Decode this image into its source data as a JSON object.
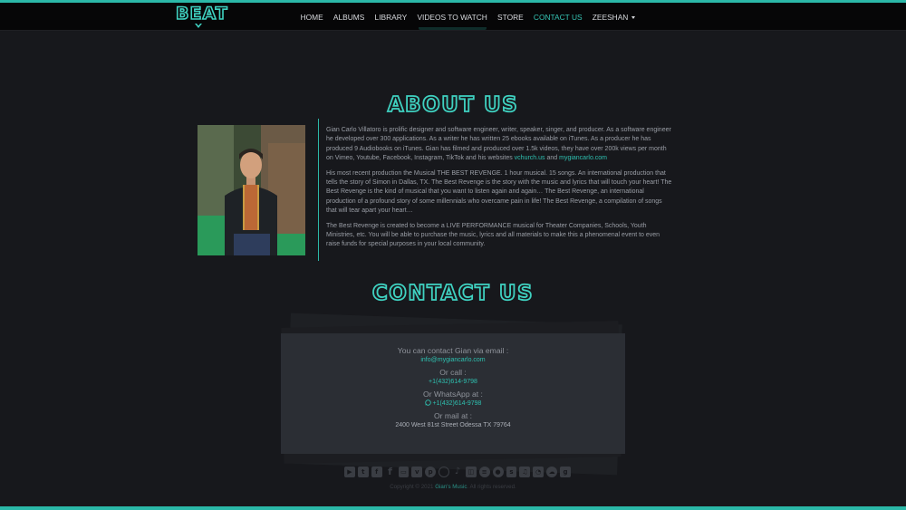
{
  "brand": {
    "logo_text": "BEAT",
    "accent_color": "#2bb8a8"
  },
  "nav": {
    "items": [
      {
        "label": "HOME",
        "active": false
      },
      {
        "label": "ALBUMS",
        "active": false
      },
      {
        "label": "LIBRARY",
        "active": false
      },
      {
        "label": "VIDEOS TO WATCH",
        "active": false
      },
      {
        "label": "STORE",
        "active": false
      },
      {
        "label": "CONTACT US",
        "active": true
      },
      {
        "label": "ZEESHAN",
        "active": false,
        "dropdown": true
      }
    ]
  },
  "about": {
    "title": "ABOUT US",
    "p1_text": "Gian Carlo Villatoro is prolific designer and software engineer, writer, speaker, singer, and producer. As a software engineer he developed over 300 applications. As a writer he has written 25 ebooks available on iTunes. As a producer he has produced 9 Audiobooks on iTunes. Gian has filmed and produced over 1.5k videos, they have over 200k views per month on Vimeo, Youtube, Facebook, Instagram, TikTok and his websites ",
    "p1_link1": "vchurch.us",
    "p1_and": " and ",
    "p1_link2": "mygiancarlo.com",
    "p2": "His most recent production the Musical THE BEST REVENGE. 1 hour musical. 15 songs. An international production that tells the story of Simon in Dallas, TX. The Best Revenge is the story with the music and lyrics that will touch your heart! The Best Revenge is the kind of musical that you want to listen again and again… The Best Revenge, an international production of a profound story of some millennials who overcame pain in life! The Best Revenge, a compilation of songs that will tear apart your heart…",
    "p3": "The Best Revenge is created to become a LIVE PERFORMANCE musical for Theater Companies, Schools, Youth Ministries, etc. You will be able to purchase the music, lyrics and all materials to make this a phenomenal event to even raise funds for special purposes in your local community."
  },
  "contact": {
    "title": "CONTACT US",
    "email_label": "You can contact Gian via email :",
    "email": "info@mygiancarlo.com",
    "call_label": "Or call :",
    "phone": "+1(432)614-9798",
    "whatsapp_label": "Or WhatsApp at :",
    "whatsapp": "+1(432)614-9798",
    "mail_label": "Or mail at :",
    "address": "2400 West 81st Street Odessa TX 79764"
  },
  "social_icons": [
    "youtube-icon",
    "twitter-icon",
    "facebook-square-icon",
    "facebook-icon",
    "flickr-icon",
    "vimeo-icon",
    "pinterest-icon",
    "instagram-icon",
    "tiktok-icon",
    "twitch-icon",
    "spotify-icon",
    "podcast-icon",
    "skype-icon",
    "itunes-icon",
    "rss-icon",
    "soundcloud-icon",
    "googleplus-icon"
  ],
  "footer": {
    "copyright_prefix": "Copyright © 2021 ",
    "brand": "Gian's Music",
    "copyright_suffix": ". All rights reserved."
  }
}
